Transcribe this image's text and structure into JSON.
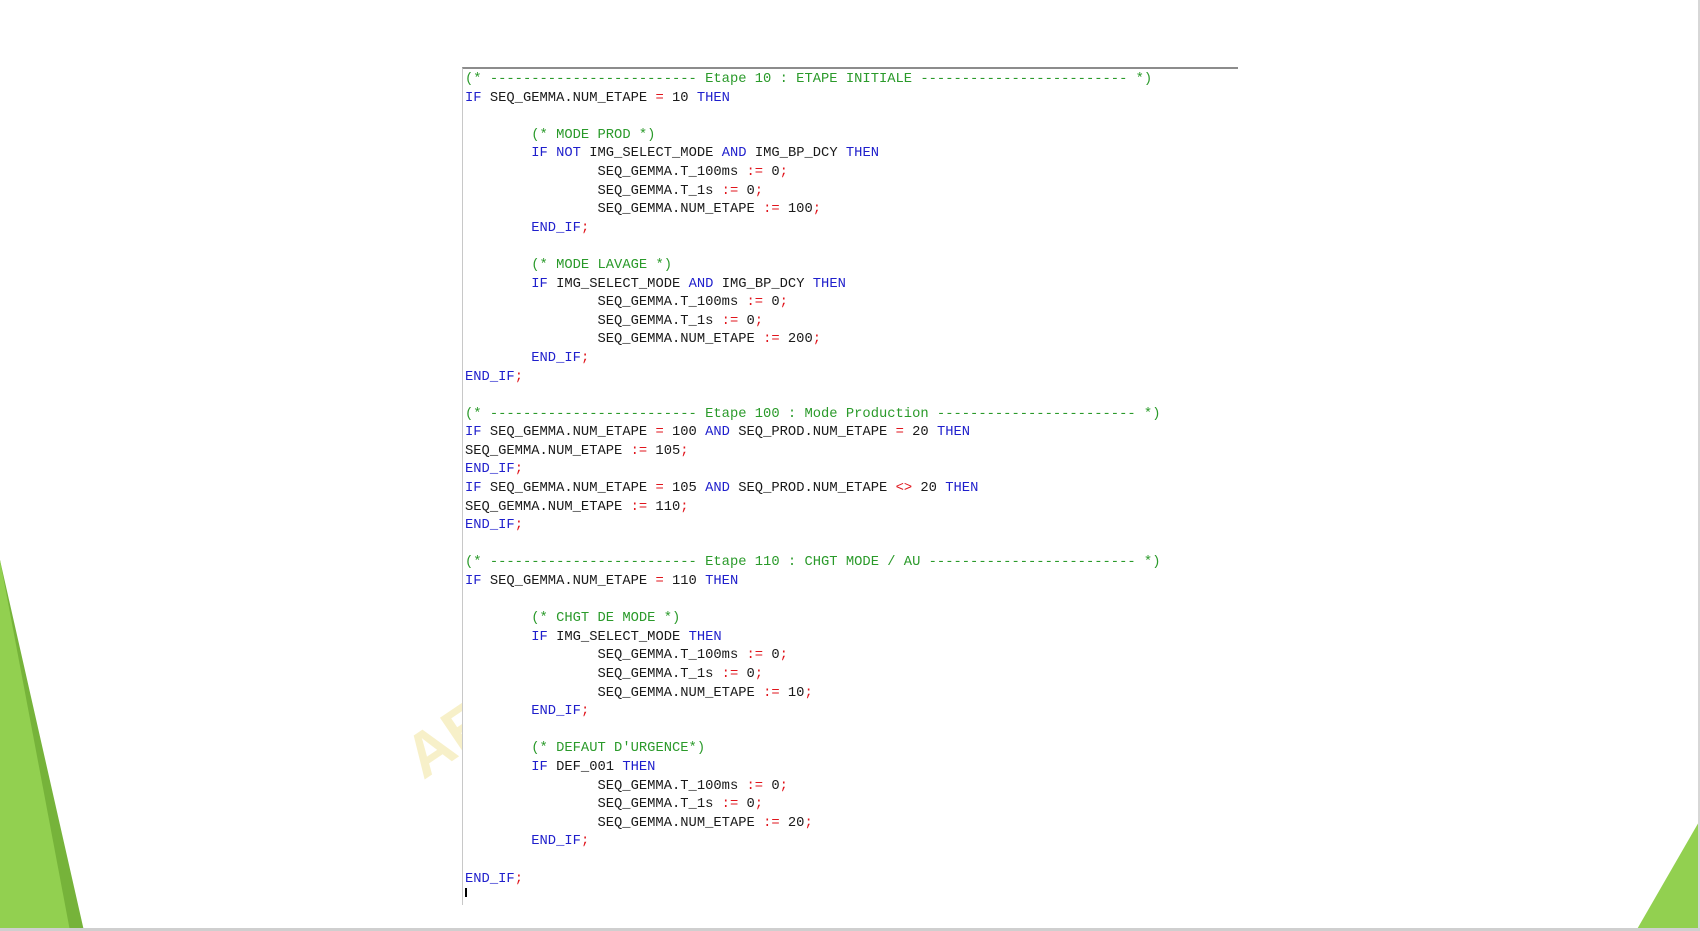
{
  "colors": {
    "keyword": "#1f1fcc",
    "comment": "#2a9a2a",
    "operator": "#e0151c",
    "identifier": "#1a1a1a",
    "accent_green": "#92d050"
  },
  "watermark": "AE",
  "code_lines": [
    [
      [
        "cm",
        "(* ------------------------- Etape 10 : ETAPE INITIALE ------------------------- *)"
      ]
    ],
    [
      [
        "kw",
        "IF"
      ],
      [
        "id",
        " SEQ_GEMMA.NUM_ETAPE "
      ],
      [
        "op",
        "="
      ],
      [
        "id",
        " 10 "
      ],
      [
        "kw",
        "THEN"
      ]
    ],
    [],
    [
      [
        "id",
        "        "
      ],
      [
        "cm",
        "(* MODE PROD *)"
      ]
    ],
    [
      [
        "id",
        "        "
      ],
      [
        "kw",
        "IF NOT"
      ],
      [
        "id",
        " IMG_SELECT_MODE "
      ],
      [
        "kw",
        "AND"
      ],
      [
        "id",
        " IMG_BP_DCY "
      ],
      [
        "kw",
        "THEN"
      ]
    ],
    [
      [
        "id",
        "                SEQ_GEMMA.T_100ms "
      ],
      [
        "op",
        ":="
      ],
      [
        "id",
        " 0"
      ],
      [
        "op",
        ";"
      ]
    ],
    [
      [
        "id",
        "                SEQ_GEMMA.T_1s "
      ],
      [
        "op",
        ":="
      ],
      [
        "id",
        " 0"
      ],
      [
        "op",
        ";"
      ]
    ],
    [
      [
        "id",
        "                SEQ_GEMMA.NUM_ETAPE "
      ],
      [
        "op",
        ":="
      ],
      [
        "id",
        " 100"
      ],
      [
        "op",
        ";"
      ]
    ],
    [
      [
        "id",
        "        "
      ],
      [
        "kw",
        "END_IF"
      ],
      [
        "op",
        ";"
      ]
    ],
    [],
    [
      [
        "id",
        "        "
      ],
      [
        "cm",
        "(* MODE LAVAGE *)"
      ]
    ],
    [
      [
        "id",
        "        "
      ],
      [
        "kw",
        "IF"
      ],
      [
        "id",
        " IMG_SELECT_MODE "
      ],
      [
        "kw",
        "AND"
      ],
      [
        "id",
        " IMG_BP_DCY "
      ],
      [
        "kw",
        "THEN"
      ]
    ],
    [
      [
        "id",
        "                SEQ_GEMMA.T_100ms "
      ],
      [
        "op",
        ":="
      ],
      [
        "id",
        " 0"
      ],
      [
        "op",
        ";"
      ]
    ],
    [
      [
        "id",
        "                SEQ_GEMMA.T_1s "
      ],
      [
        "op",
        ":="
      ],
      [
        "id",
        " 0"
      ],
      [
        "op",
        ";"
      ]
    ],
    [
      [
        "id",
        "                SEQ_GEMMA.NUM_ETAPE "
      ],
      [
        "op",
        ":="
      ],
      [
        "id",
        " 200"
      ],
      [
        "op",
        ";"
      ]
    ],
    [
      [
        "id",
        "        "
      ],
      [
        "kw",
        "END_IF"
      ],
      [
        "op",
        ";"
      ]
    ],
    [
      [
        "kw",
        "END_IF"
      ],
      [
        "op",
        ";"
      ]
    ],
    [],
    [
      [
        "cm",
        "(* ------------------------- Etape 100 : Mode Production ------------------------ *)"
      ]
    ],
    [
      [
        "kw",
        "IF"
      ],
      [
        "id",
        " SEQ_GEMMA.NUM_ETAPE "
      ],
      [
        "op",
        "="
      ],
      [
        "id",
        " 100 "
      ],
      [
        "kw",
        "AND"
      ],
      [
        "id",
        " SEQ_PROD.NUM_ETAPE "
      ],
      [
        "op",
        "="
      ],
      [
        "id",
        " 20 "
      ],
      [
        "kw",
        "THEN"
      ]
    ],
    [
      [
        "id",
        "SEQ_GEMMA.NUM_ETAPE "
      ],
      [
        "op",
        ":="
      ],
      [
        "id",
        " 105"
      ],
      [
        "op",
        ";"
      ]
    ],
    [
      [
        "kw",
        "END_IF"
      ],
      [
        "op",
        ";"
      ]
    ],
    [
      [
        "kw",
        "IF"
      ],
      [
        "id",
        " SEQ_GEMMA.NUM_ETAPE "
      ],
      [
        "op",
        "="
      ],
      [
        "id",
        " 105 "
      ],
      [
        "kw",
        "AND"
      ],
      [
        "id",
        " SEQ_PROD.NUM_ETAPE "
      ],
      [
        "op",
        "<>"
      ],
      [
        "id",
        " 20 "
      ],
      [
        "kw",
        "THEN"
      ]
    ],
    [
      [
        "id",
        "SEQ_GEMMA.NUM_ETAPE "
      ],
      [
        "op",
        ":="
      ],
      [
        "id",
        " 110"
      ],
      [
        "op",
        ";"
      ]
    ],
    [
      [
        "kw",
        "END_IF"
      ],
      [
        "op",
        ";"
      ]
    ],
    [],
    [
      [
        "cm",
        "(* ------------------------- Etape 110 : CHGT MODE / AU ------------------------- *)"
      ]
    ],
    [
      [
        "kw",
        "IF"
      ],
      [
        "id",
        " SEQ_GEMMA.NUM_ETAPE "
      ],
      [
        "op",
        "="
      ],
      [
        "id",
        " 110 "
      ],
      [
        "kw",
        "THEN"
      ]
    ],
    [],
    [
      [
        "id",
        "        "
      ],
      [
        "cm",
        "(* CHGT DE MODE *)"
      ]
    ],
    [
      [
        "id",
        "        "
      ],
      [
        "kw",
        "IF"
      ],
      [
        "id",
        " IMG_SELECT_MODE "
      ],
      [
        "kw",
        "THEN"
      ]
    ],
    [
      [
        "id",
        "                SEQ_GEMMA.T_100ms "
      ],
      [
        "op",
        ":="
      ],
      [
        "id",
        " 0"
      ],
      [
        "op",
        ";"
      ]
    ],
    [
      [
        "id",
        "                SEQ_GEMMA.T_1s "
      ],
      [
        "op",
        ":="
      ],
      [
        "id",
        " 0"
      ],
      [
        "op",
        ";"
      ]
    ],
    [
      [
        "id",
        "                SEQ_GEMMA.NUM_ETAPE "
      ],
      [
        "op",
        ":="
      ],
      [
        "id",
        " 10"
      ],
      [
        "op",
        ";"
      ]
    ],
    [
      [
        "id",
        "        "
      ],
      [
        "kw",
        "END_IF"
      ],
      [
        "op",
        ";"
      ]
    ],
    [],
    [
      [
        "id",
        "        "
      ],
      [
        "cm",
        "(* DEFAUT D'URGENCE*)"
      ]
    ],
    [
      [
        "id",
        "        "
      ],
      [
        "kw",
        "IF"
      ],
      [
        "id",
        " DEF_001 "
      ],
      [
        "kw",
        "THEN"
      ]
    ],
    [
      [
        "id",
        "                SEQ_GEMMA.T_100ms "
      ],
      [
        "op",
        ":="
      ],
      [
        "id",
        " 0"
      ],
      [
        "op",
        ";"
      ]
    ],
    [
      [
        "id",
        "                SEQ_GEMMA.T_1s "
      ],
      [
        "op",
        ":="
      ],
      [
        "id",
        " 0"
      ],
      [
        "op",
        ";"
      ]
    ],
    [
      [
        "id",
        "                SEQ_GEMMA.NUM_ETAPE "
      ],
      [
        "op",
        ":="
      ],
      [
        "id",
        " 20"
      ],
      [
        "op",
        ";"
      ]
    ],
    [
      [
        "id",
        "        "
      ],
      [
        "kw",
        "END_IF"
      ],
      [
        "op",
        ";"
      ]
    ],
    [],
    [
      [
        "kw",
        "END_IF"
      ],
      [
        "op",
        ";"
      ]
    ]
  ]
}
